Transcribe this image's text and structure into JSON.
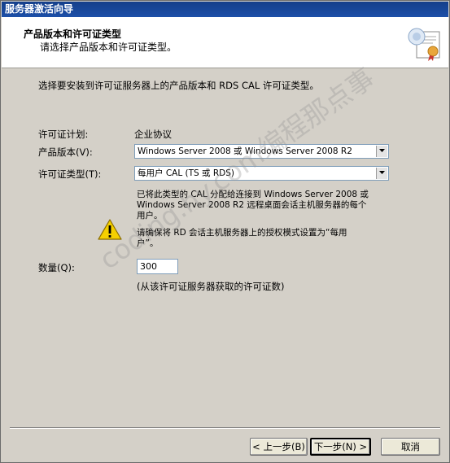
{
  "window": {
    "title": "服务器激活向导"
  },
  "header": {
    "title": "产品版本和许可证类型",
    "subtitle": "请选择产品版本和许可证类型。"
  },
  "content": {
    "intro": "选择要安装到许可证服务器上的产品版本和 RDS CAL 许可证类型。",
    "license_program_label": "许可证计划:",
    "license_program_value": "企业协议",
    "product_version_label": "产品版本(V):",
    "product_version_value": "Windows Server 2008 或 Windows Server 2008 R2",
    "license_type_label": "许可证类型(T):",
    "license_type_value": "每用户 CAL (TS 或 RDS)",
    "info_line1": "已将此类型的 CAL 分配给连接到 Windows Server 2008 或",
    "info_line2": "Windows Server 2008 R2 远程桌面会话主机服务器的每个",
    "info_line3": "用户。",
    "warning_line1": "请确保将 RD 会话主机服务器上的授权模式设置为“每用",
    "warning_line2": "户”。",
    "quantity_label": "数量(Q):",
    "quantity_value": "300",
    "quantity_hint": "(从该许可证服务器获取的许可证数)"
  },
  "buttons": {
    "back": "< 上一步(B)",
    "next": "下一步(N) >",
    "cancel": "取消"
  },
  "watermark": "coding.hy.com编程那点事"
}
